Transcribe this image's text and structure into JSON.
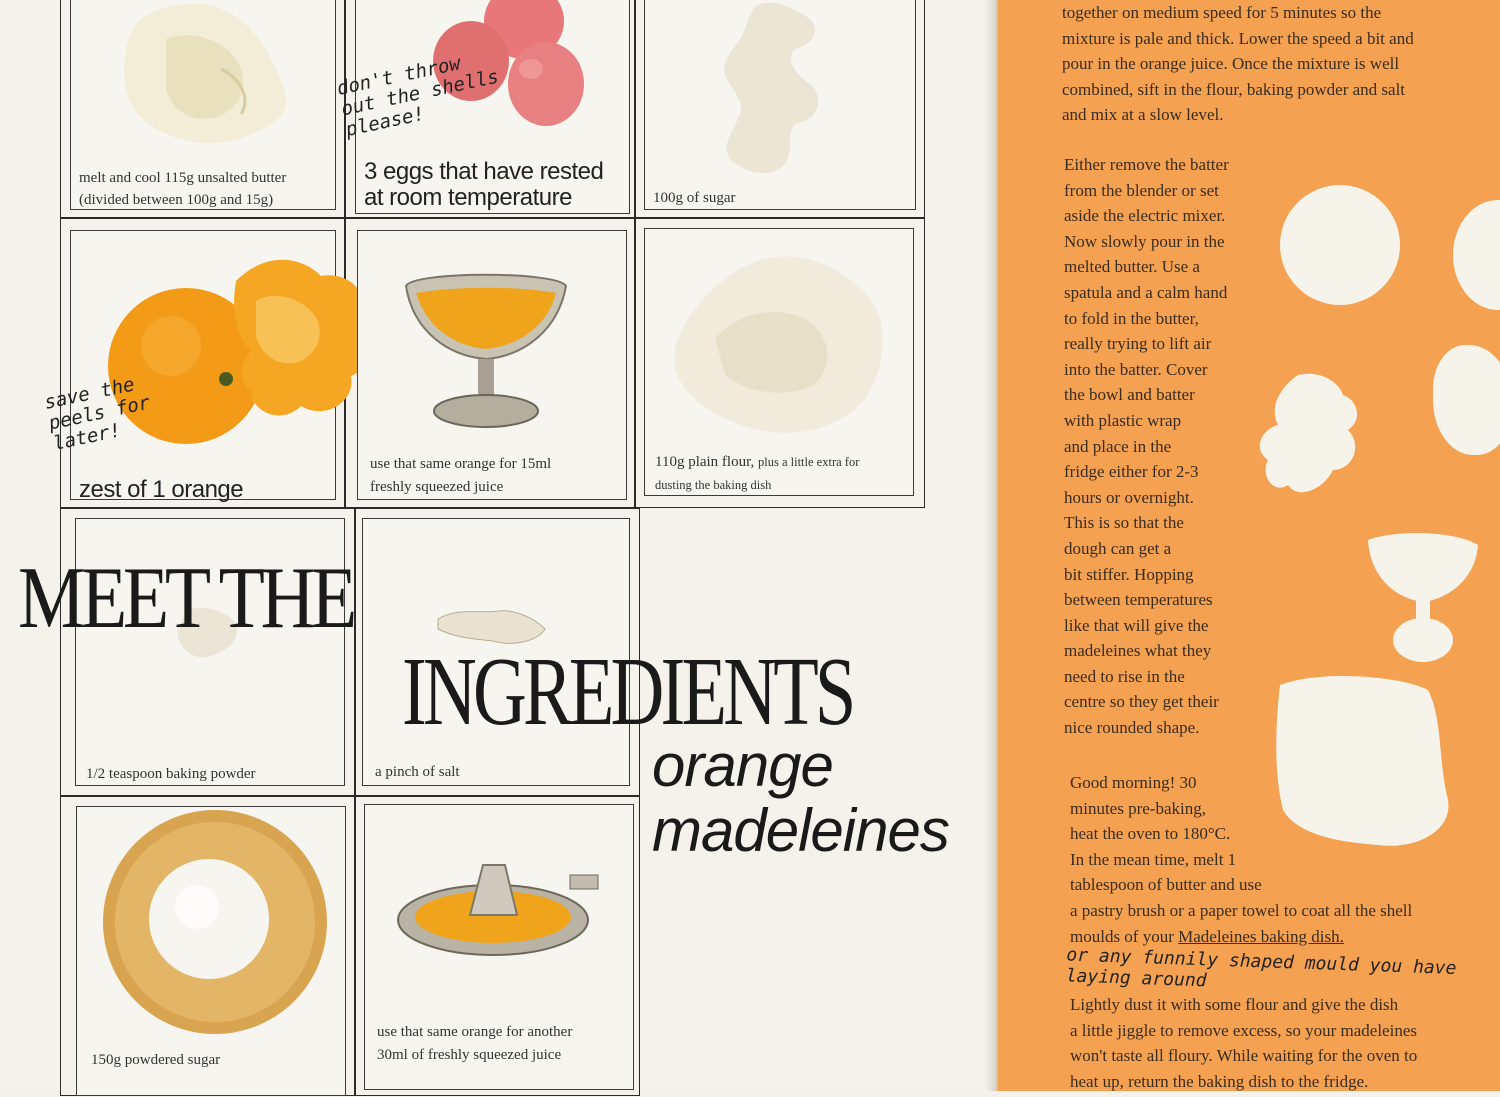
{
  "cards": [
    {
      "id": "butter",
      "caption_line1": "melt and cool 115g unsalted butter",
      "caption_line2": "(divided between 100g and 15g)"
    },
    {
      "id": "eggs",
      "caption_line1": "3 eggs that have rested",
      "caption_line2": "at room temperature",
      "note_lines": [
        "don't throw",
        "out the shells",
        "please!"
      ]
    },
    {
      "id": "sugar",
      "caption": "100g of sugar"
    },
    {
      "id": "zest",
      "caption": "zest of 1 orange",
      "note_lines": [
        "save the",
        "peels for",
        "later!"
      ]
    },
    {
      "id": "juice",
      "caption_line1": "use that same orange for 15ml",
      "caption_line2": "freshly squeezed juice"
    },
    {
      "id": "flour",
      "caption_main": "110g plain flour,",
      "caption_extra": "plus a little extra for",
      "caption_line2": "dusting the baking dish"
    },
    {
      "id": "baking_powder",
      "caption": "1/2 teaspoon baking powder"
    },
    {
      "id": "salt",
      "caption": "a pinch of salt"
    },
    {
      "id": "powdered_sugar",
      "caption": "150g powdered sugar"
    },
    {
      "id": "more_juice",
      "caption_line1": "use that same orange for another",
      "caption_line2": "30ml of freshly squeezed juice"
    }
  ],
  "title": {
    "line1": "MEET THE",
    "line2": "INGREDIENTS",
    "sub1": "orange",
    "sub2": "madeleines"
  },
  "right_page": {
    "p1": [
      "together on medium speed for 5 minutes so the",
      "mixture is pale and thick. Lower the speed a bit and",
      "pour in the orange juice. Once the mixture is well",
      "combined, sift in the flour, baking powder and salt",
      "and mix at a slow level."
    ],
    "p2": [
      "Either remove the batter",
      "from the blender or set",
      "aside the electric mixer.",
      "Now slowly pour in the",
      "melted butter. Use a",
      "spatula and a calm hand",
      "to fold in the butter,",
      "really trying to lift air",
      "into the batter. Cover",
      "the bowl and batter",
      "with plastic wrap",
      "and place in the",
      "fridge either for 2-3",
      "hours or overnight.",
      "This is so that the",
      "dough can get a",
      "bit stiffer. Hopping",
      "between temperatures",
      "like that will give the",
      "madeleines what they",
      "need to rise in the",
      "centre so they get their",
      "nice rounded shape."
    ],
    "p3": [
      "Good morning! 30",
      "minutes pre-baking,",
      "heat the oven to 180°C.",
      "In the mean time, melt 1",
      "tablespoon of butter and use",
      "a pastry brush or a paper towel to coat all the shell"
    ],
    "p3_last_prefix": "moulds of your ",
    "p3_link": "Madeleines baking dish.",
    "handnote": "or any funnily shaped mould you have laying around",
    "p4": [
      "Lightly dust it with some flour and give the dish",
      "a little jiggle to remove excess, so your madeleines",
      "won't taste all floury. While waiting for the oven to",
      "heat up, return the baking dish to the fridge."
    ]
  },
  "colors": {
    "orange_page": "#f4a151",
    "paper": "#f4f2eb",
    "ink": "#1a1a1a"
  }
}
